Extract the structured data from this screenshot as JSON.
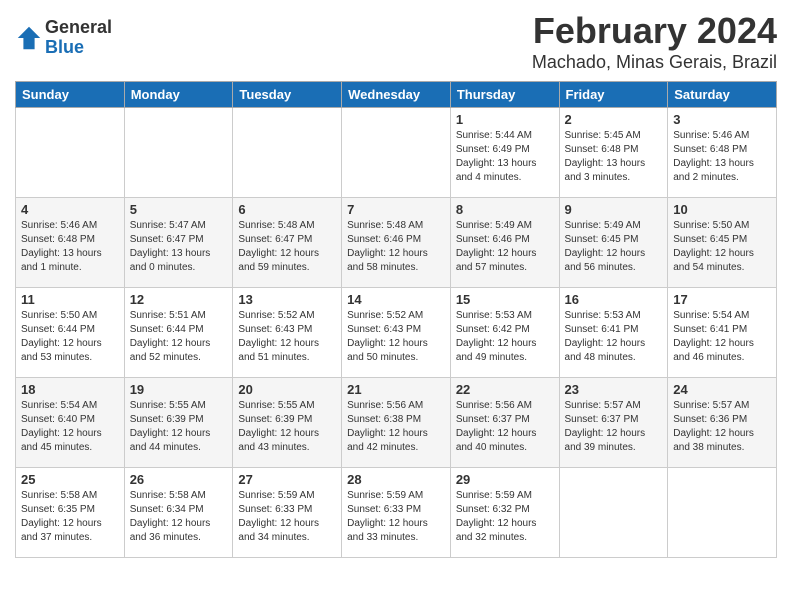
{
  "header": {
    "logo_general": "General",
    "logo_blue": "Blue",
    "month_title": "February 2024",
    "location": "Machado, Minas Gerais, Brazil"
  },
  "days_of_week": [
    "Sunday",
    "Monday",
    "Tuesday",
    "Wednesday",
    "Thursday",
    "Friday",
    "Saturday"
  ],
  "weeks": [
    [
      {
        "day": "",
        "info": ""
      },
      {
        "day": "",
        "info": ""
      },
      {
        "day": "",
        "info": ""
      },
      {
        "day": "",
        "info": ""
      },
      {
        "day": "1",
        "info": "Sunrise: 5:44 AM\nSunset: 6:49 PM\nDaylight: 13 hours\nand 4 minutes."
      },
      {
        "day": "2",
        "info": "Sunrise: 5:45 AM\nSunset: 6:48 PM\nDaylight: 13 hours\nand 3 minutes."
      },
      {
        "day": "3",
        "info": "Sunrise: 5:46 AM\nSunset: 6:48 PM\nDaylight: 13 hours\nand 2 minutes."
      }
    ],
    [
      {
        "day": "4",
        "info": "Sunrise: 5:46 AM\nSunset: 6:48 PM\nDaylight: 13 hours\nand 1 minute."
      },
      {
        "day": "5",
        "info": "Sunrise: 5:47 AM\nSunset: 6:47 PM\nDaylight: 13 hours\nand 0 minutes."
      },
      {
        "day": "6",
        "info": "Sunrise: 5:48 AM\nSunset: 6:47 PM\nDaylight: 12 hours\nand 59 minutes."
      },
      {
        "day": "7",
        "info": "Sunrise: 5:48 AM\nSunset: 6:46 PM\nDaylight: 12 hours\nand 58 minutes."
      },
      {
        "day": "8",
        "info": "Sunrise: 5:49 AM\nSunset: 6:46 PM\nDaylight: 12 hours\nand 57 minutes."
      },
      {
        "day": "9",
        "info": "Sunrise: 5:49 AM\nSunset: 6:45 PM\nDaylight: 12 hours\nand 56 minutes."
      },
      {
        "day": "10",
        "info": "Sunrise: 5:50 AM\nSunset: 6:45 PM\nDaylight: 12 hours\nand 54 minutes."
      }
    ],
    [
      {
        "day": "11",
        "info": "Sunrise: 5:50 AM\nSunset: 6:44 PM\nDaylight: 12 hours\nand 53 minutes."
      },
      {
        "day": "12",
        "info": "Sunrise: 5:51 AM\nSunset: 6:44 PM\nDaylight: 12 hours\nand 52 minutes."
      },
      {
        "day": "13",
        "info": "Sunrise: 5:52 AM\nSunset: 6:43 PM\nDaylight: 12 hours\nand 51 minutes."
      },
      {
        "day": "14",
        "info": "Sunrise: 5:52 AM\nSunset: 6:43 PM\nDaylight: 12 hours\nand 50 minutes."
      },
      {
        "day": "15",
        "info": "Sunrise: 5:53 AM\nSunset: 6:42 PM\nDaylight: 12 hours\nand 49 minutes."
      },
      {
        "day": "16",
        "info": "Sunrise: 5:53 AM\nSunset: 6:41 PM\nDaylight: 12 hours\nand 48 minutes."
      },
      {
        "day": "17",
        "info": "Sunrise: 5:54 AM\nSunset: 6:41 PM\nDaylight: 12 hours\nand 46 minutes."
      }
    ],
    [
      {
        "day": "18",
        "info": "Sunrise: 5:54 AM\nSunset: 6:40 PM\nDaylight: 12 hours\nand 45 minutes."
      },
      {
        "day": "19",
        "info": "Sunrise: 5:55 AM\nSunset: 6:39 PM\nDaylight: 12 hours\nand 44 minutes."
      },
      {
        "day": "20",
        "info": "Sunrise: 5:55 AM\nSunset: 6:39 PM\nDaylight: 12 hours\nand 43 minutes."
      },
      {
        "day": "21",
        "info": "Sunrise: 5:56 AM\nSunset: 6:38 PM\nDaylight: 12 hours\nand 42 minutes."
      },
      {
        "day": "22",
        "info": "Sunrise: 5:56 AM\nSunset: 6:37 PM\nDaylight: 12 hours\nand 40 minutes."
      },
      {
        "day": "23",
        "info": "Sunrise: 5:57 AM\nSunset: 6:37 PM\nDaylight: 12 hours\nand 39 minutes."
      },
      {
        "day": "24",
        "info": "Sunrise: 5:57 AM\nSunset: 6:36 PM\nDaylight: 12 hours\nand 38 minutes."
      }
    ],
    [
      {
        "day": "25",
        "info": "Sunrise: 5:58 AM\nSunset: 6:35 PM\nDaylight: 12 hours\nand 37 minutes."
      },
      {
        "day": "26",
        "info": "Sunrise: 5:58 AM\nSunset: 6:34 PM\nDaylight: 12 hours\nand 36 minutes."
      },
      {
        "day": "27",
        "info": "Sunrise: 5:59 AM\nSunset: 6:33 PM\nDaylight: 12 hours\nand 34 minutes."
      },
      {
        "day": "28",
        "info": "Sunrise: 5:59 AM\nSunset: 6:33 PM\nDaylight: 12 hours\nand 33 minutes."
      },
      {
        "day": "29",
        "info": "Sunrise: 5:59 AM\nSunset: 6:32 PM\nDaylight: 12 hours\nand 32 minutes."
      },
      {
        "day": "",
        "info": ""
      },
      {
        "day": "",
        "info": ""
      }
    ]
  ]
}
